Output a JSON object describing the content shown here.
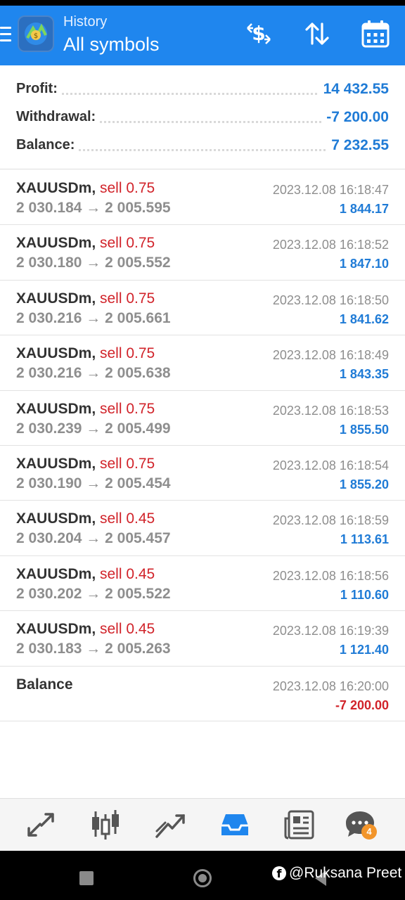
{
  "header": {
    "title": "History",
    "subtitle": "All symbols",
    "icons": [
      "menu-icon",
      "metatrader-logo",
      "deposit-currency-icon",
      "sort-icon",
      "calendar-icon"
    ]
  },
  "summary": [
    {
      "label": "Profit:",
      "value": "14 432.55"
    },
    {
      "label": "Withdrawal:",
      "value": "-7 200.00"
    },
    {
      "label": "Balance:",
      "value": "7 232.55"
    }
  ],
  "deals": [
    {
      "symbol": "XAUUSDm,",
      "type": "sell 0.75",
      "open": "2 030.184",
      "arrow": "→",
      "close": "2 005.595",
      "time": "2023.12.08 16:18:47",
      "profit": "1 844.17"
    },
    {
      "symbol": "XAUUSDm,",
      "type": "sell 0.75",
      "open": "2 030.180",
      "arrow": "→",
      "close": "2 005.552",
      "time": "2023.12.08 16:18:52",
      "profit": "1 847.10"
    },
    {
      "symbol": "XAUUSDm,",
      "type": "sell 0.75",
      "open": "2 030.216",
      "arrow": "→",
      "close": "2 005.661",
      "time": "2023.12.08 16:18:50",
      "profit": "1 841.62"
    },
    {
      "symbol": "XAUUSDm,",
      "type": "sell 0.75",
      "open": "2 030.216",
      "arrow": "→",
      "close": "2 005.638",
      "time": "2023.12.08 16:18:49",
      "profit": "1 843.35"
    },
    {
      "symbol": "XAUUSDm,",
      "type": "sell 0.75",
      "open": "2 030.239",
      "arrow": "→",
      "close": "2 005.499",
      "time": "2023.12.08 16:18:53",
      "profit": "1 855.50"
    },
    {
      "symbol": "XAUUSDm,",
      "type": "sell 0.75",
      "open": "2 030.190",
      "arrow": "→",
      "close": "2 005.454",
      "time": "2023.12.08 16:18:54",
      "profit": "1 855.20"
    },
    {
      "symbol": "XAUUSDm,",
      "type": "sell 0.45",
      "open": "2 030.204",
      "arrow": "→",
      "close": "2 005.457",
      "time": "2023.12.08 16:18:59",
      "profit": "1 113.61"
    },
    {
      "symbol": "XAUUSDm,",
      "type": "sell 0.45",
      "open": "2 030.202",
      "arrow": "→",
      "close": "2 005.522",
      "time": "2023.12.08 16:18:56",
      "profit": "1 110.60"
    },
    {
      "symbol": "XAUUSDm,",
      "type": "sell 0.45",
      "open": "2 030.183",
      "arrow": "→",
      "close": "2 005.263",
      "time": "2023.12.08 16:19:39",
      "profit": "1 121.40"
    }
  ],
  "balance_entry": {
    "label": "Balance",
    "time": "2023.12.08 16:20:00",
    "amount": "-7 200.00"
  },
  "bottom_nav": {
    "items": [
      "quotes-icon",
      "chart-icon",
      "trade-icon",
      "history-icon",
      "news-icon",
      "messages-icon"
    ],
    "active": "history-icon",
    "messages_badge": "4"
  },
  "watermark": {
    "icon": "f",
    "text": "@Ruksana Preet"
  },
  "colors": {
    "accent": "#1f86ee",
    "profit": "#1f7bd6",
    "loss": "#d1232a",
    "sell": "#d1232a"
  }
}
